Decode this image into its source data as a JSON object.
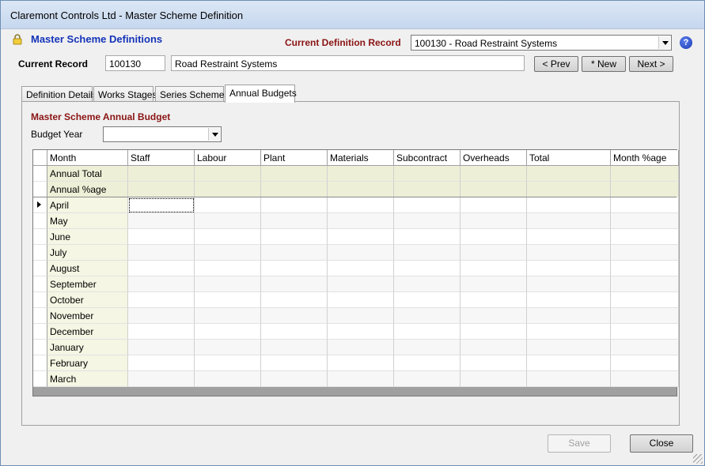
{
  "window": {
    "title": "Claremont Controls Ltd - Master Scheme Definition"
  },
  "header": {
    "page_title": "Master Scheme Definitions",
    "current_definition_label": "Current Definition Record",
    "current_definition_value": "100130 - Road Restraint Systems",
    "help_symbol": "?"
  },
  "record": {
    "label": "Current Record",
    "code": "100130",
    "name": "Road Restraint Systems",
    "prev_label": "< Prev",
    "new_label": "* New",
    "next_label": "Next >"
  },
  "tabs": [
    {
      "label": "Definition Details"
    },
    {
      "label": "Works Stages"
    },
    {
      "label": "Series Schemes"
    },
    {
      "label": "Annual Budgets",
      "active": true
    }
  ],
  "annual_budget": {
    "section_title": "Master Scheme Annual Budget",
    "budget_year_label": "Budget Year",
    "budget_year_value": "",
    "grid": {
      "columns": [
        "Month",
        "Staff",
        "Labour",
        "Plant",
        "Materials",
        "Subcontract",
        "Overheads",
        "Total",
        "Month %age"
      ],
      "summary_rows": [
        "Annual Total",
        "Annual %age"
      ],
      "months": [
        "April",
        "May",
        "June",
        "July",
        "August",
        "September",
        "October",
        "November",
        "December",
        "January",
        "February",
        "March"
      ]
    }
  },
  "footer": {
    "save_label": "Save",
    "close_label": "Close"
  }
}
